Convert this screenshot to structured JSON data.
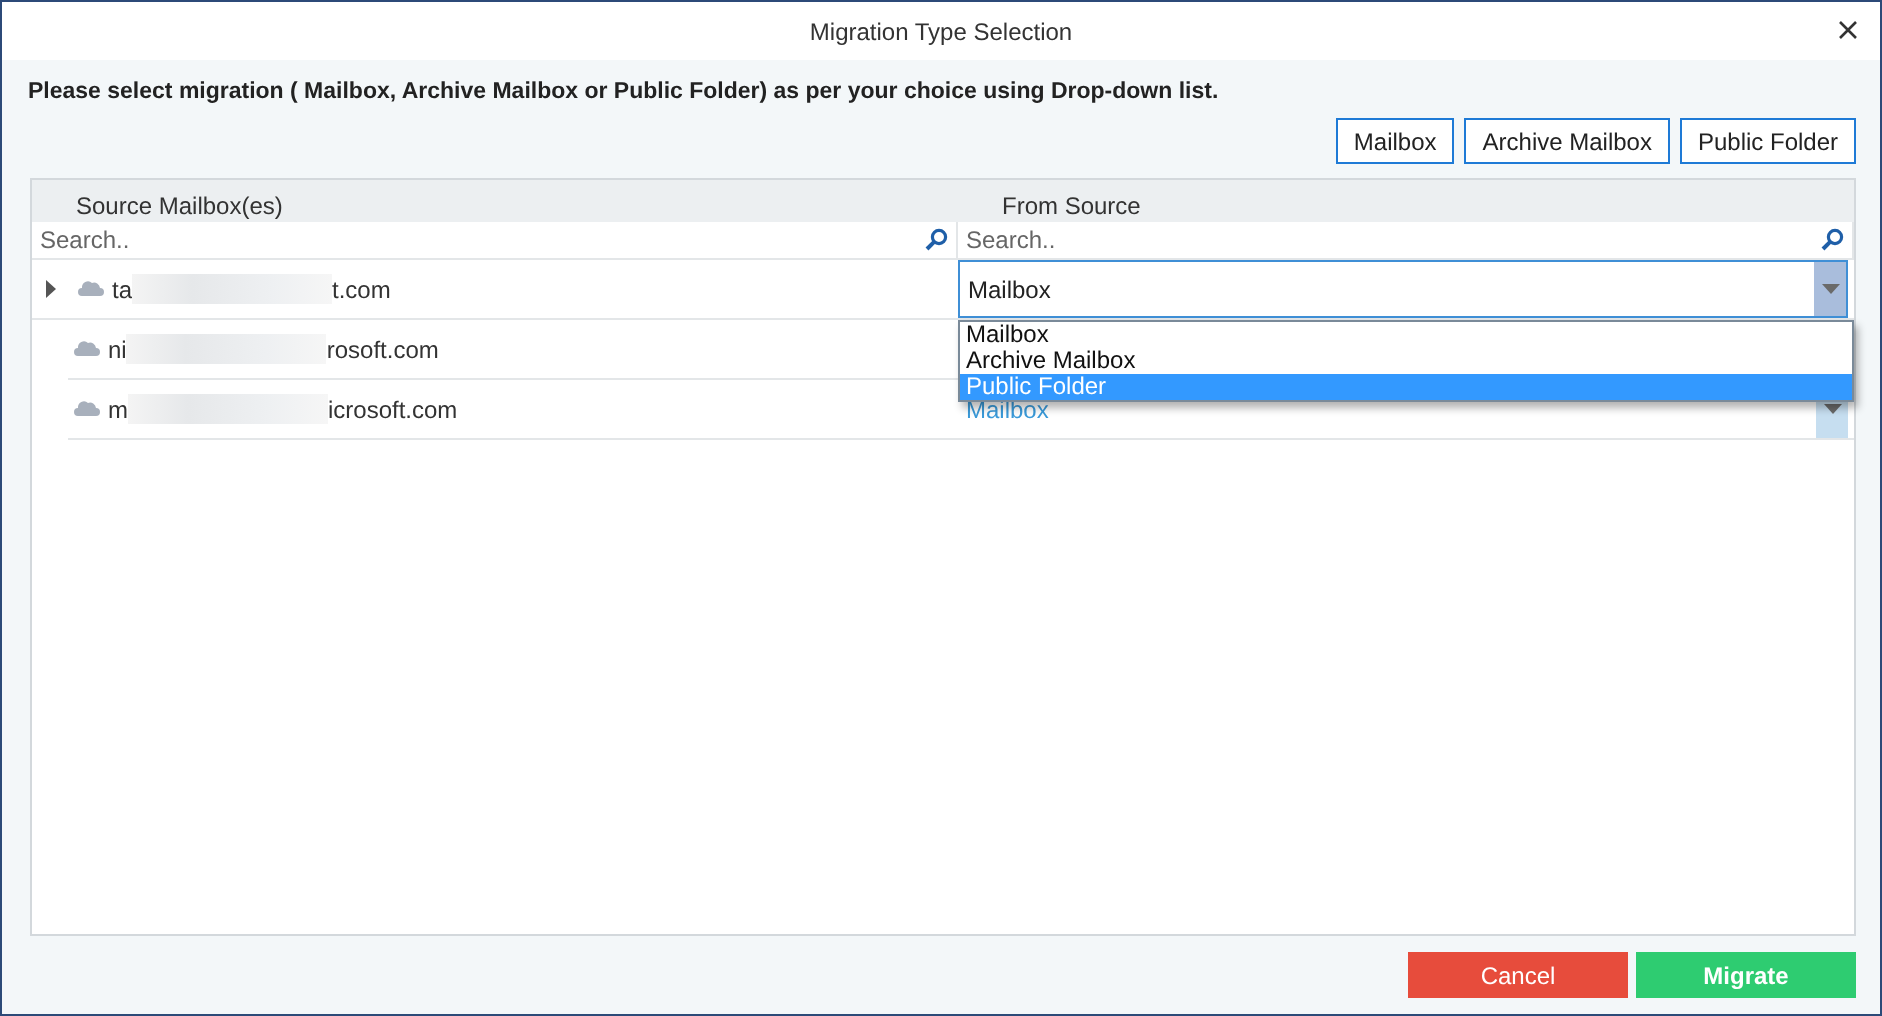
{
  "window": {
    "title": "Migration Type Selection"
  },
  "instruction": "Please select migration ( Mailbox, Archive Mailbox or Public Folder) as per your choice using Drop-down list.",
  "type_buttons": [
    "Mailbox",
    "Archive Mailbox",
    "Public Folder"
  ],
  "grid": {
    "columns": [
      {
        "header": "Source Mailbox(es)",
        "placeholder": "Search.."
      },
      {
        "header": "From Source",
        "placeholder": "Search.."
      }
    ],
    "rows": [
      {
        "expandable": true,
        "email_start": "ta",
        "email_end": "t.com",
        "from_source": {
          "value": "Mailbox",
          "editing": true
        }
      },
      {
        "expandable": false,
        "email_start": "ni",
        "email_end": "rosoft.com"
      },
      {
        "expandable": false,
        "email_start": "m",
        "email_end": "icrosoft.com",
        "from_source": {
          "value": "Mailbox",
          "editing": false
        }
      }
    ],
    "dropdown": {
      "options": [
        {
          "label": "Mailbox",
          "selected": false
        },
        {
          "label": "Archive Mailbox",
          "selected": false
        },
        {
          "label": "Public Folder",
          "selected": true
        }
      ]
    }
  },
  "footer_buttons": [
    {
      "label": "Cancel",
      "kind": "cancel"
    },
    {
      "label": "Migrate",
      "kind": "primary"
    }
  ]
}
